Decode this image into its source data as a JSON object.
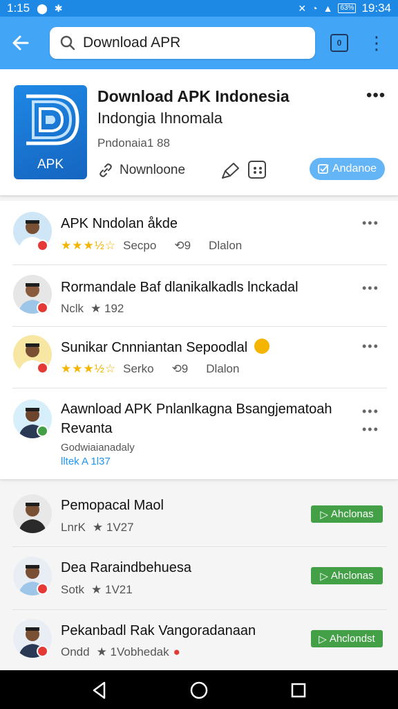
{
  "status_bar": {
    "time_left": "1:15",
    "time_right": "19:34",
    "battery": "63%"
  },
  "toolbar": {
    "search_value": "Download APR",
    "square_label": "0"
  },
  "app": {
    "title": "Download APK Indonesia",
    "subtitle": "Indongia Ihnomala",
    "meta": "Pndonaia1 88",
    "icon_label": "APK",
    "download_label": "Nownloone",
    "install_label": "Andanoe"
  },
  "list": [
    {
      "title": "APK Nndolan åkde",
      "rating": "★★★½☆",
      "meta1": "Secpo",
      "meta2": "⟲9",
      "meta3": "Dlalon",
      "badge": "#e53935",
      "avatar": "#cfe6f7"
    },
    {
      "title": "Rormandale Baf dlanikalkadls lnckadal",
      "meta1": "Nclk",
      "meta2": "★ 192",
      "badge": "#e53935",
      "avatar": "#e6e6e6"
    },
    {
      "title": "Sunikar Cnnniantan Sepoodlal",
      "rating": "★★★½☆",
      "meta1": "Serko",
      "meta2": "⟲9",
      "meta3": "Dlalon",
      "badge": "#e53935",
      "avatar": "#f7e7a3"
    },
    {
      "title": "Aawnload APK Pnlanlkagna Bsangjematoah",
      "title2": "Revanta",
      "meta1": "Godwiaianadaly",
      "meta2": "lltek  A 1l37",
      "badge": "#43a047",
      "avatar": "#d7eefb"
    }
  ],
  "list2": [
    {
      "title": "Pemopacal Maol",
      "meta1": "LnrK",
      "meta2": "★ 1V27",
      "button": "Ahclonas",
      "badge": "",
      "avatar": "#e8e8e8"
    },
    {
      "title": "Dea Raraindbehuesa",
      "meta1": "Sotk",
      "meta2": "★ 1V21",
      "button": "Ahclonas",
      "badge": "#e53935",
      "avatar": "#e8eef3"
    },
    {
      "title": "Pekanbadl Rak Vangoradanaan",
      "meta1": "Ondd",
      "meta2": "★ 1Vobhedak",
      "button": "Ahclondst",
      "badge": "#e53935",
      "avatar": "#e8eef3"
    }
  ],
  "colors": {
    "primary": "#42a5f5",
    "status": "#1e88e5",
    "green": "#43a047",
    "star": "#f5b400",
    "badge_red": "#e53935"
  }
}
